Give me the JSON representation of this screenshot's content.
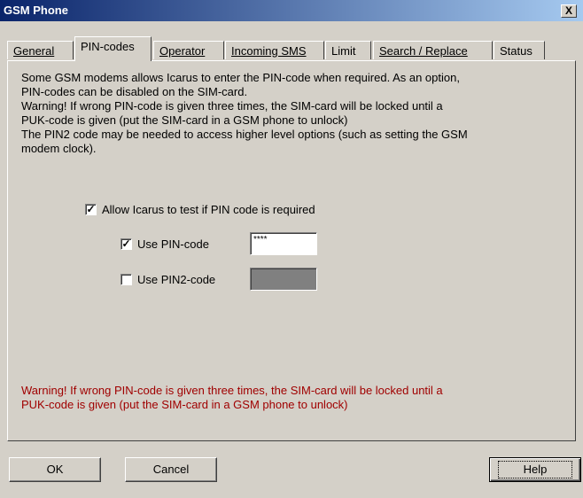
{
  "window": {
    "title": "GSM Phone",
    "close_label": "X"
  },
  "tabs": [
    {
      "label": "General"
    },
    {
      "label": "PIN-codes"
    },
    {
      "label": "Operator"
    },
    {
      "label": "Incoming SMS"
    },
    {
      "label": "Limit"
    },
    {
      "label": "Search / Replace"
    },
    {
      "label": "Status"
    }
  ],
  "info": {
    "line1": "Some GSM modems allows Icarus to enter the PIN-code when required. As an option,",
    "line2": "PIN-codes can be disabled on the SIM-card.",
    "line3": "Warning! If wrong PIN-code is given three times, the SIM-card will be locked until a",
    "line4": "PUK-code is given (put the SIM-card in a GSM phone to unlock)",
    "line5": "The PIN2 code may be needed to access higher level options (such as setting the GSM",
    "line6": "modem clock)."
  },
  "options": {
    "allow_test": {
      "label": "Allow Icarus to test if PIN code is required",
      "checked": true,
      "mark": "✓"
    },
    "use_pin": {
      "label": "Use PIN-code",
      "checked": true,
      "mark": "✓",
      "value": "****"
    },
    "use_pin2": {
      "label": "Use PIN2-code",
      "checked": false,
      "value": ""
    }
  },
  "warning": {
    "line1": "Warning! If wrong PIN-code is given three times, the SIM-card will be locked until a",
    "line2": "PUK-code is given (put the SIM-card in a GSM phone to unlock)"
  },
  "buttons": {
    "ok": "OK",
    "cancel": "Cancel",
    "help": "Help"
  }
}
